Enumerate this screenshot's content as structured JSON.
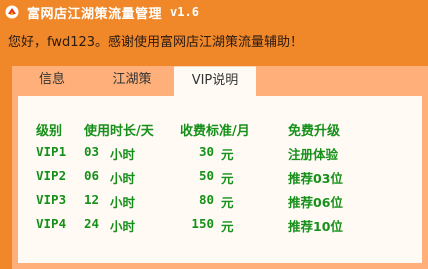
{
  "window": {
    "title": "富网店江湖策流量管理",
    "version": "v1.6"
  },
  "greeting": "您好，fwd123。感谢使用富网店江湖策流量辅助！",
  "tabs": [
    {
      "label": "信息",
      "active": false
    },
    {
      "label": "江湖策",
      "active": false
    },
    {
      "label": "VIP说明",
      "active": true
    }
  ],
  "table": {
    "headers": [
      "级别",
      "使用时长/天",
      "收费标准/月",
      "免费升级"
    ],
    "rows": [
      {
        "level": "VIP1",
        "days": "03",
        "days_unit": "小时",
        "price": "30",
        "currency": "元",
        "upgrade": "注册体验"
      },
      {
        "level": "VIP2",
        "days": "06",
        "days_unit": "小时",
        "price": "50",
        "currency": "元",
        "upgrade": "推荐03位"
      },
      {
        "level": "VIP3",
        "days": "12",
        "days_unit": "小时",
        "price": "80",
        "currency": "元",
        "upgrade": "推荐06位"
      },
      {
        "level": "VIP4",
        "days": "24",
        "days_unit": "小时",
        "price": "150",
        "currency": "元",
        "upgrade": "推荐10位"
      }
    ]
  },
  "colors": {
    "background": "#f0882a",
    "panel": "#ffb07a",
    "content": "#fffbf4",
    "text_green": "#16901a"
  }
}
